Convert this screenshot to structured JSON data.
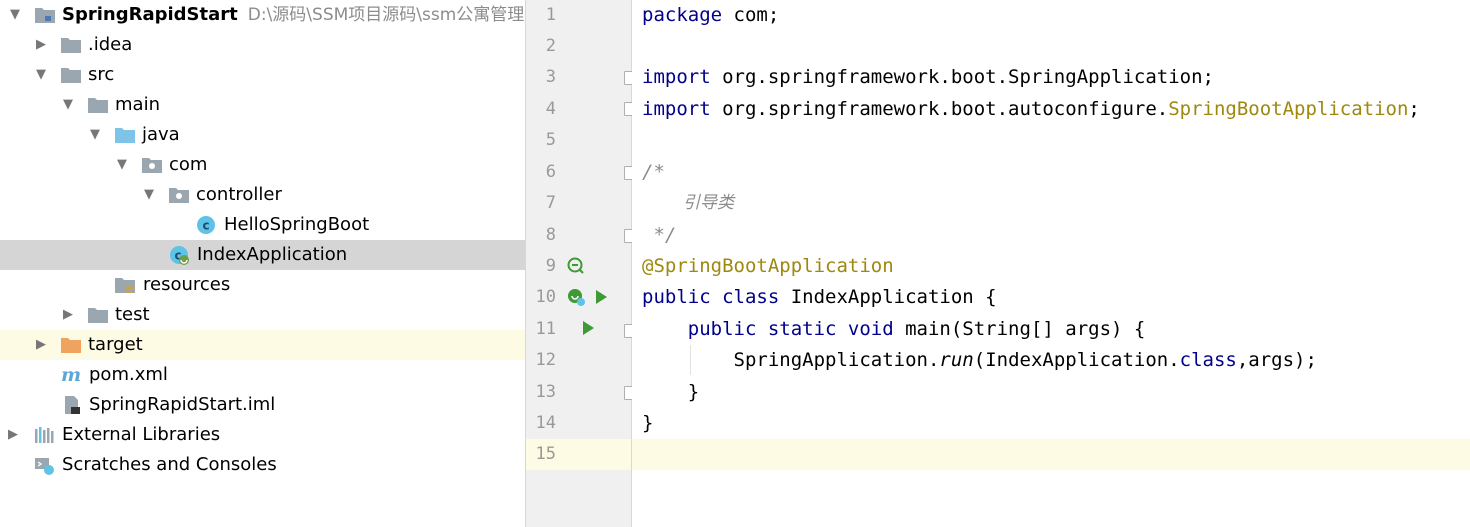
{
  "tree": {
    "root": {
      "name": "SpringRapidStart",
      "path": "D:\\源码\\SSM项目源码\\ssm公寓管理系"
    },
    "items": [
      {
        "label": ".idea"
      },
      {
        "label": "src"
      },
      {
        "label": "main"
      },
      {
        "label": "java"
      },
      {
        "label": "com"
      },
      {
        "label": "controller"
      },
      {
        "label": "HelloSpringBoot"
      },
      {
        "label": "IndexApplication"
      },
      {
        "label": "resources"
      },
      {
        "label": "test"
      },
      {
        "label": "target"
      },
      {
        "label": "pom.xml"
      },
      {
        "label": "SpringRapidStart.iml"
      },
      {
        "label": "External Libraries"
      },
      {
        "label": "Scratches and Consoles"
      }
    ]
  },
  "editor": {
    "line_numbers": [
      "1",
      "2",
      "3",
      "4",
      "5",
      "6",
      "7",
      "8",
      "9",
      "10",
      "11",
      "12",
      "13",
      "14",
      "15"
    ],
    "current_line": "15",
    "code": {
      "l1_kw": "package",
      "l1_rest": " com;",
      "l3_kw": "import",
      "l3_rest": " org.springframework.boot.SpringApplication;",
      "l4_kw": "import",
      "l4_rest": " org.springframework.boot.autoconfigure.",
      "l4_ann": "SpringBootApplication",
      "l4_end": ";",
      "l6": "/*",
      "l7": "    引导类",
      "l8": " */",
      "l9": "@SpringBootApplication",
      "l10_kw": "public class",
      "l10_rest": " IndexApplication {",
      "l11_indent": "    ",
      "l11_kw": "public static void",
      "l11_rest": " main(String[] args) {",
      "l12_a": "        SpringApplication.",
      "l12_run": "run",
      "l12_b": "(IndexApplication.",
      "l12_cls": "class",
      "l12_c": ",args);",
      "l13": "    }",
      "l14": "}"
    }
  },
  "colors": {
    "keyword": "#00008b",
    "annotation": "#9e880d",
    "comment": "#8c8c8c",
    "folder": "#9aa7b0",
    "source_folder": "#7ec4e8",
    "target_folder": "#f0a35e",
    "run": "#3d9a35",
    "class_icon": "#5ec3e6"
  }
}
